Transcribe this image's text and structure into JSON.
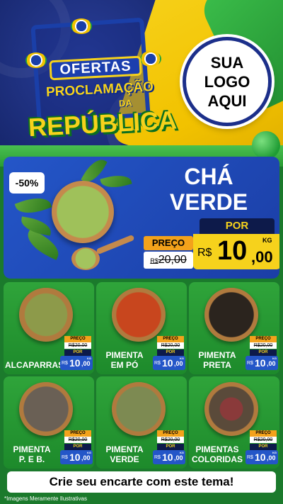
{
  "header": {
    "title_line1": "OFERTAS",
    "title_line2": "PROCLAMAÇÃO",
    "title_da": "DA",
    "title_line3": "REPÚBLICA",
    "logo_line1": "SUA",
    "logo_line2": "LOGO",
    "logo_line3": "AQUI"
  },
  "featured": {
    "discount": "-50%",
    "name_line1": "CHÁ",
    "name_line2": "VERDE",
    "preco_label": "PREÇO",
    "old_currency": "R$",
    "old_price": "20,00",
    "por_label": "POR",
    "new_currency": "R$",
    "new_int": "10",
    "new_dec": ",00",
    "unit": "KG"
  },
  "products": [
    {
      "name_line1": "ALCAPARRAS",
      "name_line2": "",
      "preco_label": "PREÇO",
      "old_price": "R$20,00",
      "por_label": "POR",
      "currency": "R$",
      "int": "10",
      "dec": ",00",
      "unit": "KG"
    },
    {
      "name_line1": "PIMENTA",
      "name_line2": "EM PÓ",
      "preco_label": "PREÇO",
      "old_price": "R$20,00",
      "por_label": "POR",
      "currency": "R$",
      "int": "10",
      "dec": ",00",
      "unit": "KG"
    },
    {
      "name_line1": "PIMENTA",
      "name_line2": "PRETA",
      "preco_label": "PREÇO",
      "old_price": "R$20,00",
      "por_label": "POR",
      "currency": "R$",
      "int": "10",
      "dec": ",00",
      "unit": "KG"
    },
    {
      "name_line1": "PIMENTA",
      "name_line2": "P. E B.",
      "preco_label": "PREÇO",
      "old_price": "R$20,00",
      "por_label": "POR",
      "currency": "R$",
      "int": "10",
      "dec": ",00",
      "unit": "KG"
    },
    {
      "name_line1": "PIMENTA",
      "name_line2": "VERDE",
      "preco_label": "PREÇO",
      "old_price": "R$20,00",
      "por_label": "POR",
      "currency": "R$",
      "int": "10",
      "dec": ",00",
      "unit": "KG"
    },
    {
      "name_line1": "PIMENTAS",
      "name_line2": "COLORIDAS",
      "preco_label": "PREÇO",
      "old_price": "R$20,00",
      "por_label": "POR",
      "currency": "R$",
      "int": "10",
      "dec": ",00",
      "unit": "KG"
    }
  ],
  "footer": {
    "cta": "Crie seu encarte com este tema!",
    "disclaimer": "*Imagens Meramente Ilustrativas"
  },
  "colors": {
    "header_blue": "#17276e",
    "brand_yellow": "#f6d21c",
    "brand_green": "#2fa43a",
    "card_blue": "#2456c8",
    "preco_orange": "#f3a21b"
  }
}
